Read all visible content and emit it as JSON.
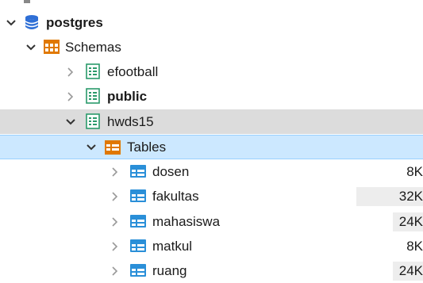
{
  "tree": {
    "server": {
      "label": "postgres",
      "icon": "database-icon"
    },
    "schemas": {
      "label": "Schemas",
      "icon": "schemas-icon"
    },
    "schema_items": [
      {
        "label": "efootball",
        "icon": "schema-icon",
        "expanded": false
      },
      {
        "label": "public",
        "icon": "schema-icon",
        "expanded": false,
        "bold": true
      },
      {
        "label": "hwds15",
        "icon": "schema-icon",
        "expanded": true
      }
    ],
    "tables_node": {
      "label": "Tables",
      "icon": "tables-folder-icon"
    },
    "tables": [
      {
        "label": "dosen",
        "size": "8K"
      },
      {
        "label": "fakultas",
        "size": "32K"
      },
      {
        "label": "mahasiswa",
        "size": "24K"
      },
      {
        "label": "matkul",
        "size": "8K"
      },
      {
        "label": "ruang",
        "size": "24K"
      }
    ]
  },
  "colors": {
    "selection": "#cce8ff",
    "row_highlight": "#dcdcdc",
    "db_icon": "#2f6fd6",
    "folder_icon": "#e07800",
    "table_icon": "#2a8fd8"
  }
}
